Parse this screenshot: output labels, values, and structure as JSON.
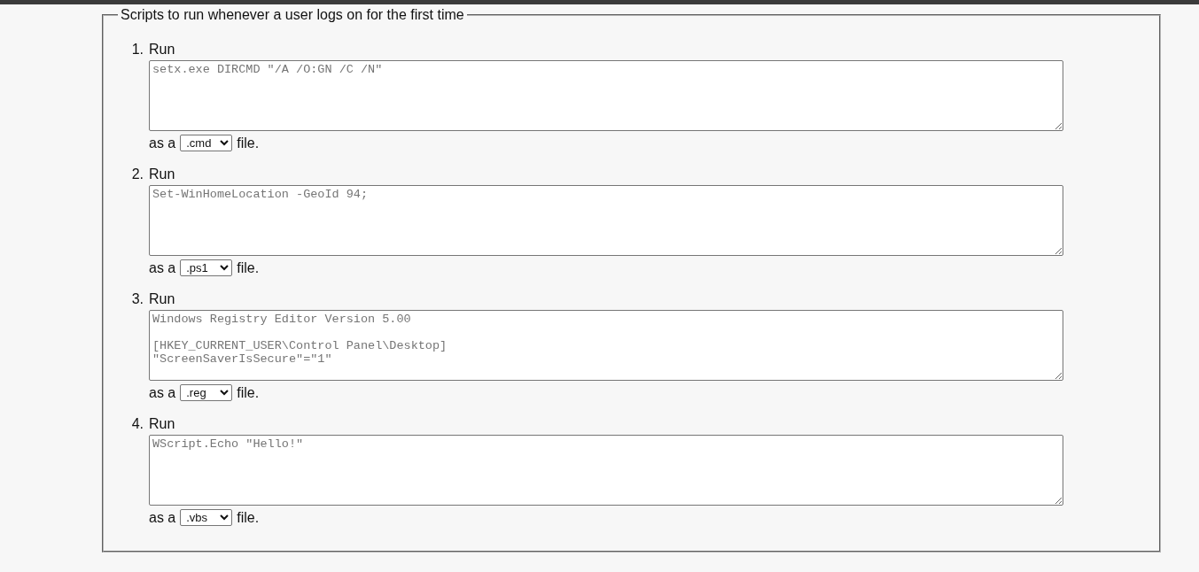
{
  "fieldset": {
    "legend": "Scripts to run whenever a user logs on for the first time"
  },
  "scripts": [
    {
      "number": "1.",
      "label": "Run",
      "placeholder": "setx.exe DIRCMD \"/A /O:GN /C /N\"",
      "prefix": "as a",
      "file_type": ".cmd",
      "suffix": "file."
    },
    {
      "number": "2.",
      "label": "Run",
      "placeholder": "Set-WinHomeLocation -GeoId 94;",
      "prefix": "as a",
      "file_type": ".ps1",
      "suffix": "file."
    },
    {
      "number": "3.",
      "label": "Run",
      "placeholder": "Windows Registry Editor Version 5.00\n\n[HKEY_CURRENT_USER\\Control Panel\\Desktop]\n\"ScreenSaverIsSecure\"=\"1\"",
      "prefix": "as a",
      "file_type": ".reg",
      "suffix": "file."
    },
    {
      "number": "4.",
      "label": "Run",
      "placeholder": "WScript.Echo \"Hello!\"",
      "prefix": "as a",
      "file_type": ".vbs",
      "suffix": "file."
    }
  ]
}
